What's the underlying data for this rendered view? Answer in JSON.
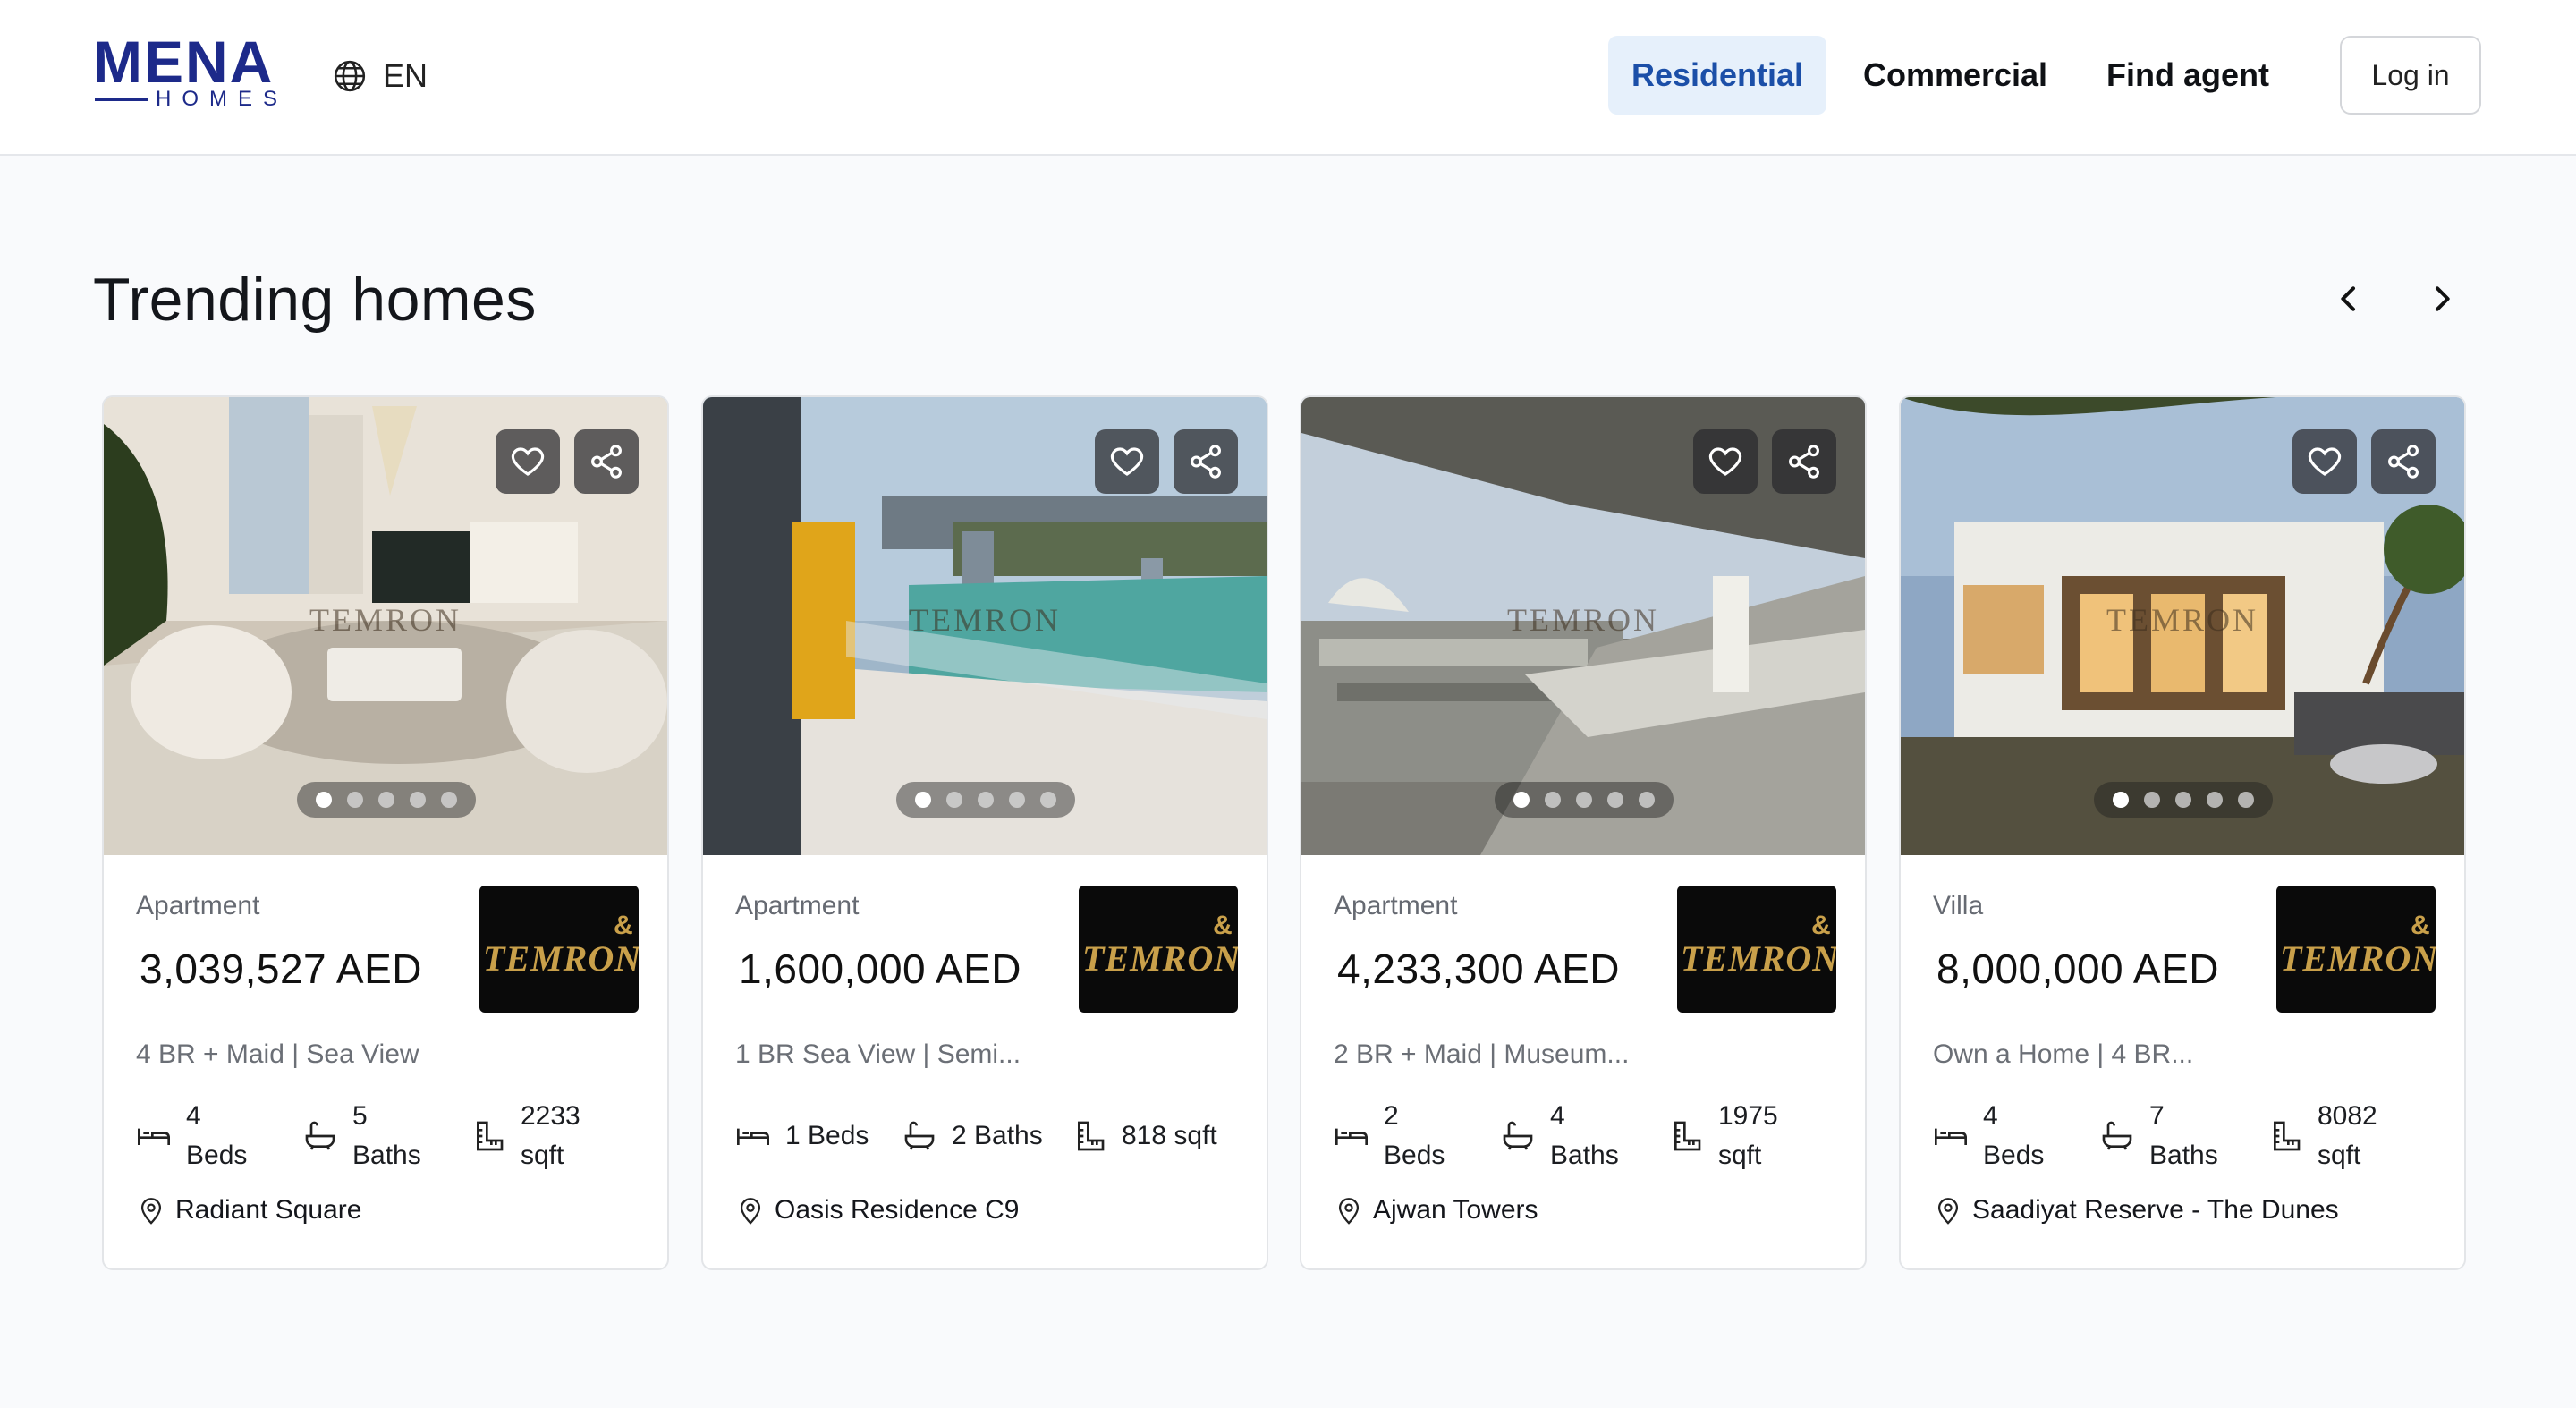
{
  "brand": {
    "name": "MENA",
    "sub": "HOMES",
    "color": "#1d2a8a"
  },
  "language": {
    "icon": "globe-icon",
    "label": "EN"
  },
  "nav": {
    "residential": "Residential",
    "commercial": "Commercial",
    "find_agent": "Find agent",
    "login": "Log in"
  },
  "section": {
    "title": "Trending homes",
    "prev_icon": "chevron-left-icon",
    "next_icon": "chevron-right-icon"
  },
  "cards": [
    {
      "type": "Apartment",
      "price": "3,039,527  AED",
      "title": "4 BR + Maid | Sea View",
      "beds": "4 Beds",
      "baths": "5 Baths",
      "area": "2233 sqft",
      "location": "Radiant Square",
      "agency": "TEMRON",
      "watermark": "TEMRON",
      "slides": 5,
      "active_slide": 1
    },
    {
      "type": "Apartment",
      "price": "1,600,000  AED",
      "title": "1 BR Sea View | Semi...",
      "beds": "1 Beds",
      "baths": "2 Baths",
      "area": "818 sqft",
      "location": "Oasis Residence C9",
      "agency": "TEMRON",
      "watermark": "TEMRON",
      "slides": 5,
      "active_slide": 1
    },
    {
      "type": "Apartment",
      "price": "4,233,300  AED",
      "title": "2 BR + Maid | Museum...",
      "beds": "2 Beds",
      "baths": "4 Baths",
      "area": "1975 sqft",
      "location": "Ajwan Towers",
      "agency": "TEMRON",
      "watermark": "TEMRON",
      "slides": 5,
      "active_slide": 1
    },
    {
      "type": "Villa",
      "price": "8,000,000  AED",
      "title": "Own a Home | 4 BR...",
      "beds": "4 Beds",
      "baths": "7 Baths",
      "area": "8082 sqft",
      "location": "Saadiyat Reserve - The Dunes",
      "agency": "TEMRON",
      "watermark": "TEMRON",
      "slides": 5,
      "active_slide": 1
    }
  ],
  "icons": {
    "favorite": "heart-icon",
    "share": "share-icon",
    "beds": "bed-icon",
    "baths": "bathtub-icon",
    "area": "area-ruler-icon",
    "location": "map-pin-icon"
  }
}
